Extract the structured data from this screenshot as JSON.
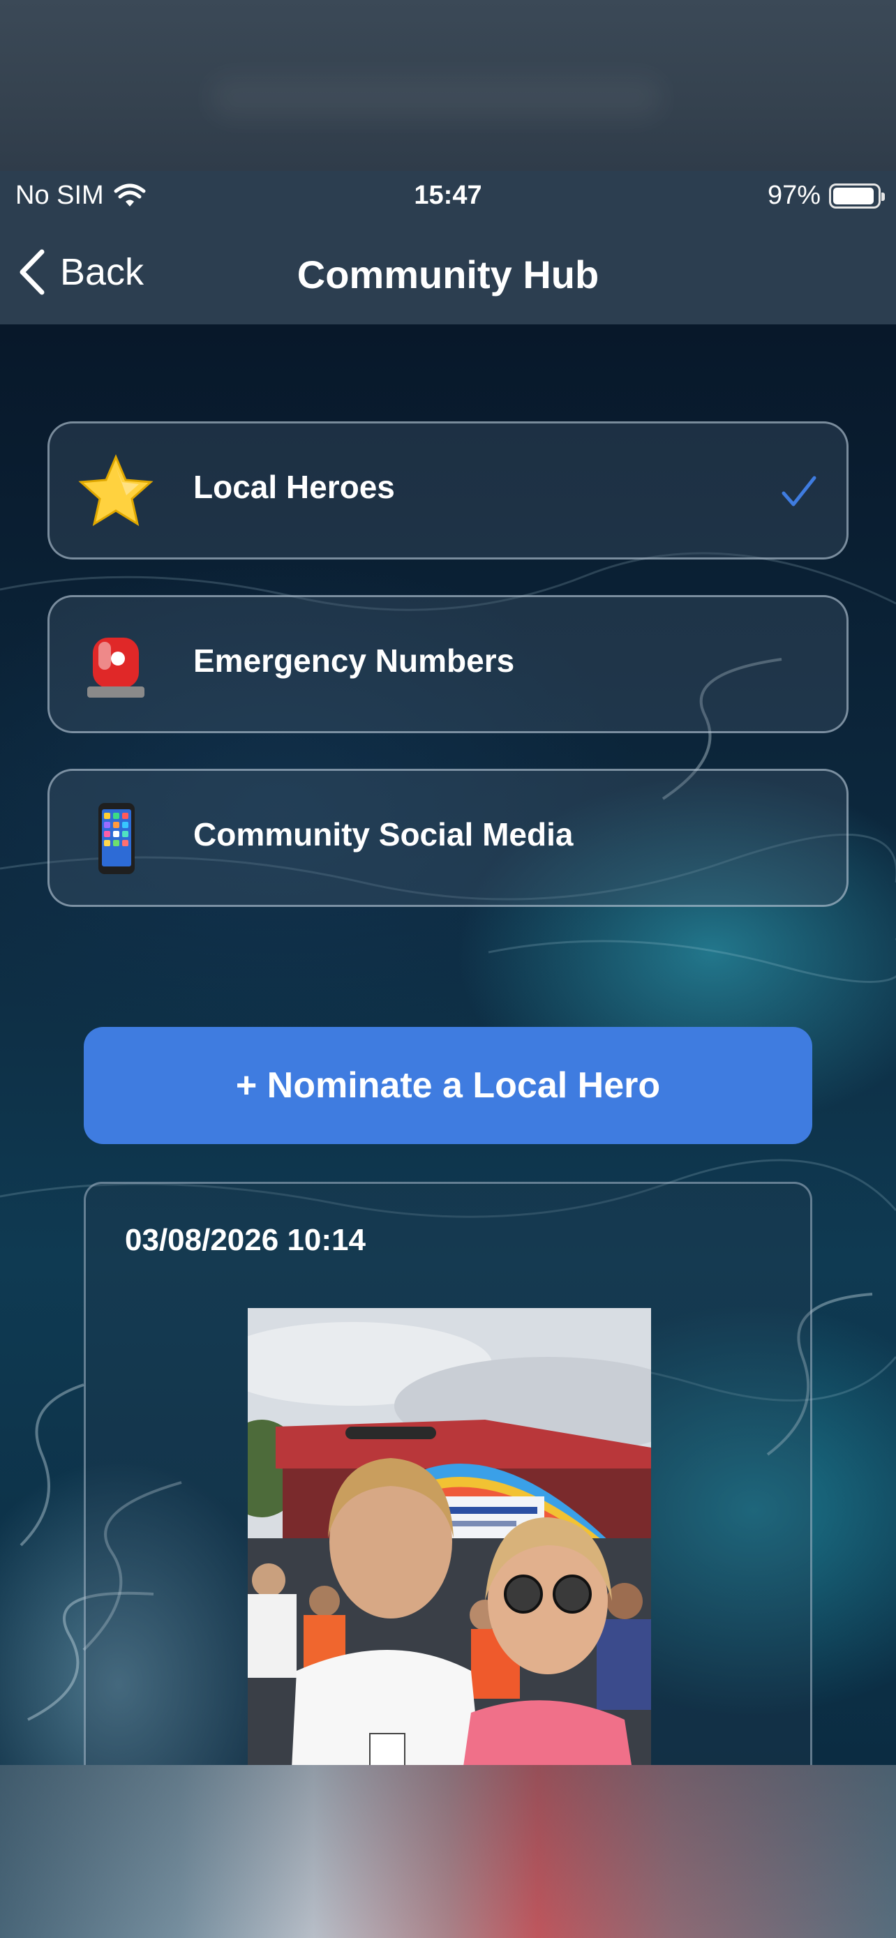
{
  "status_bar": {
    "carrier": "No SIM",
    "time": "15:47",
    "battery": "97%"
  },
  "nav": {
    "back_label": "Back",
    "title": "Community Hub"
  },
  "menu": [
    {
      "label": "Local Heroes",
      "icon": "star-icon",
      "selected": true
    },
    {
      "label": "Emergency Numbers",
      "icon": "siren-icon",
      "selected": false
    },
    {
      "label": "Community Social Media",
      "icon": "mobile-phone-icon",
      "selected": false
    }
  ],
  "nominate_button": "+ Nominate a Local Hero",
  "post": {
    "date": "03/08/2026 10:14",
    "photo_icon": "event-selfie-photo"
  },
  "colors": {
    "nav_bg": "#2c3e50",
    "accent": "#3f7ce0",
    "check": "#3f7ce0"
  }
}
